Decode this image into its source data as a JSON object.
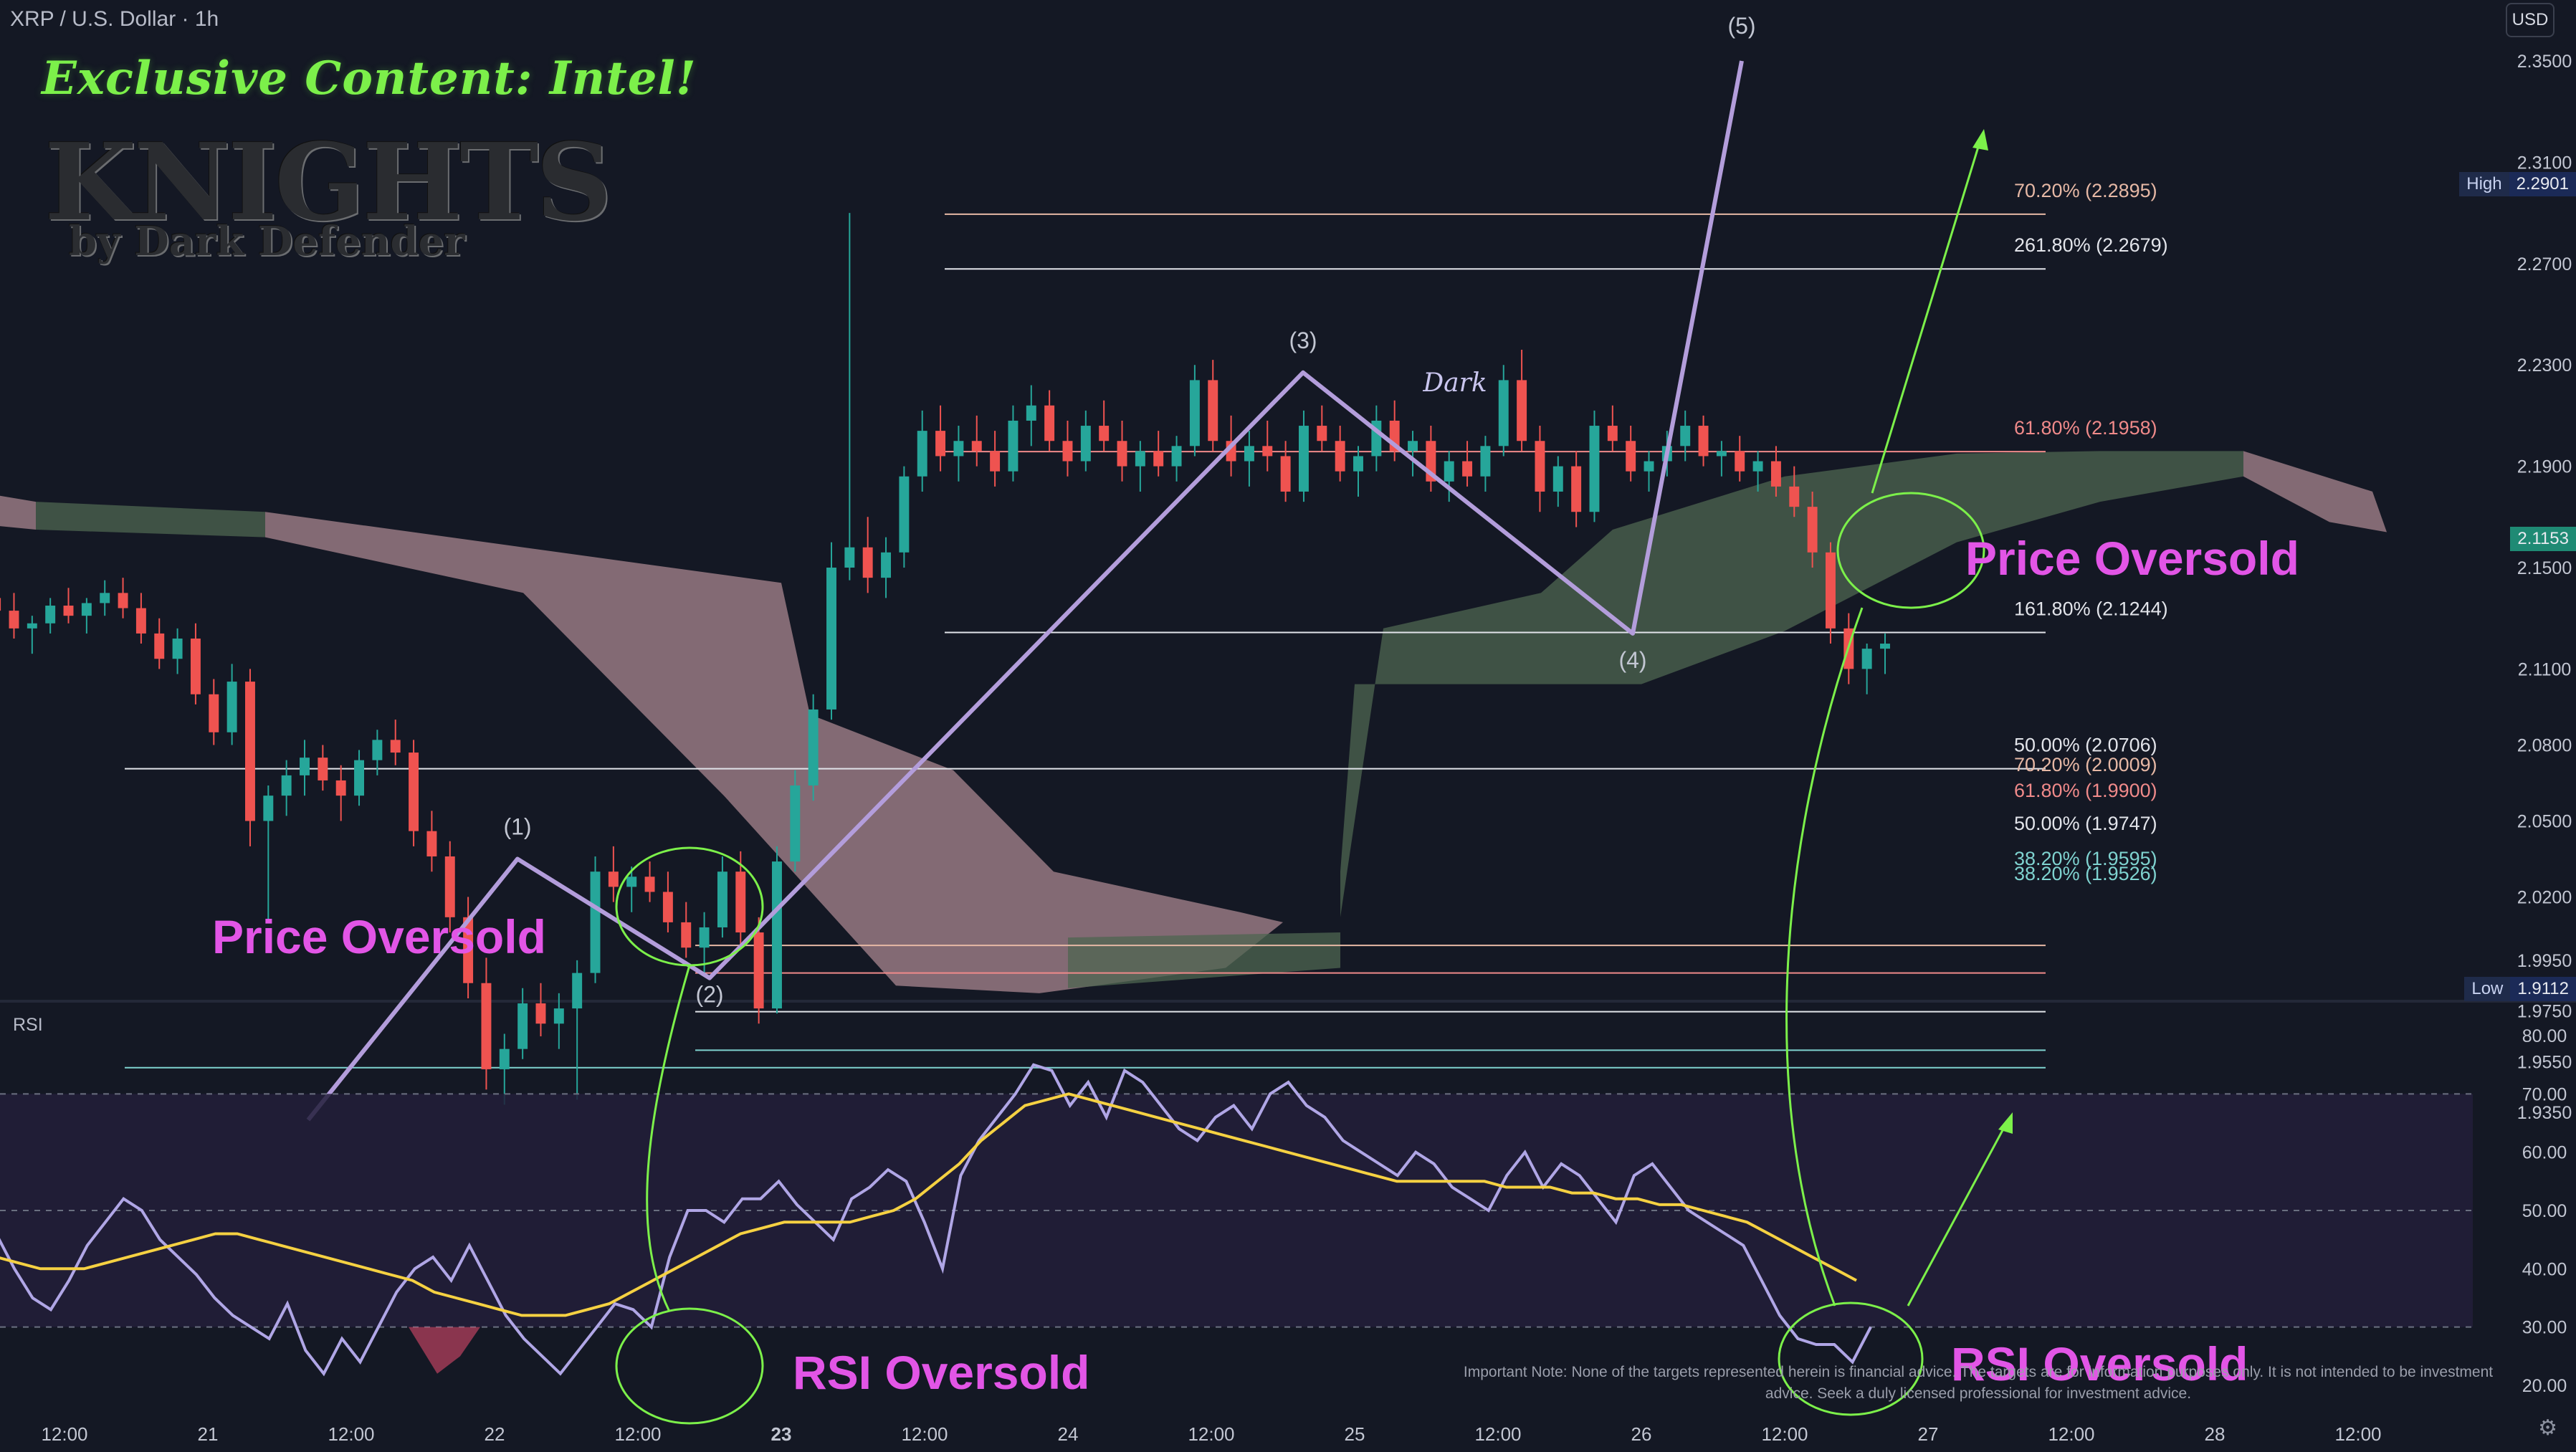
{
  "header": {
    "symbol": "XRP / U.S. Dollar · 1h",
    "currency": "USD"
  },
  "watermark": {
    "tagline": "Exclusive Content: Intel!",
    "brand": "KNIGHTS",
    "byline": "by Dark Defender",
    "mid_label": "Dark"
  },
  "price_tags": {
    "high_label": "High",
    "high_value": "2.2901",
    "current_value": "2.1153",
    "low_label": "Low",
    "low_value": "1.9112"
  },
  "rsi_title": "RSI",
  "disclaimer": "Important Note: None of the targets represented herein is financial advice. The targets are for information purposes only. It is not intended to be investment advice. Seek a duly licensed professional for investment advice.",
  "colors": {
    "background": "#141824",
    "bull": "#26a69a",
    "bear": "#ef5350",
    "wave": "#b39ddb",
    "annotation": "#e255e6",
    "arrow": "#7cf04a",
    "rsi_line": "#b0a6e6",
    "rsi_ma": "#f5d142",
    "cloud_bull": "#4e6650",
    "cloud_bear": "#a8868f"
  },
  "chart_data": [
    {
      "type": "candlestick",
      "pair": "XRP / U.S. Dollar",
      "timeframe": "1h",
      "ylim": [
        1.91,
        2.36
      ],
      "y_ticks": [
        "2.3500",
        "2.3100",
        "2.2700",
        "2.2300",
        "2.1900",
        "2.1500",
        "2.1100",
        "2.0800",
        "2.0500",
        "2.0200",
        "1.9950",
        "1.9750",
        "1.9550",
        "1.9350"
      ],
      "x_ticks": [
        "12:00",
        "21",
        "12:00",
        "22",
        "12:00",
        "23",
        "12:00",
        "24",
        "12:00",
        "25",
        "12:00",
        "26",
        "12:00",
        "27",
        "12:00",
        "28",
        "12:00"
      ],
      "x_range": [
        19.5,
        28.3
      ],
      "high": 2.2901,
      "low": 1.9112,
      "last": 2.1153,
      "ohlc": [
        [
          2.16,
          2.166,
          2.148,
          2.152
        ],
        [
          2.152,
          2.172,
          2.145,
          2.168
        ],
        [
          2.168,
          2.18,
          2.16,
          2.172
        ],
        [
          2.172,
          2.178,
          2.15,
          2.156
        ],
        [
          2.156,
          2.175,
          2.152,
          2.17
        ],
        [
          2.17,
          2.182,
          2.162,
          2.178
        ],
        [
          2.178,
          2.185,
          2.168,
          2.173
        ],
        [
          2.173,
          2.179,
          2.158,
          2.165
        ],
        [
          2.165,
          2.17,
          2.135,
          2.142
        ],
        [
          2.142,
          2.148,
          2.122,
          2.129
        ],
        [
          2.129,
          2.136,
          2.118,
          2.132
        ],
        [
          2.132,
          2.14,
          2.126,
          2.138
        ],
        [
          2.138,
          2.146,
          2.13,
          2.133
        ],
        [
          2.133,
          2.14,
          2.122,
          2.126
        ],
        [
          2.126,
          2.131,
          2.116,
          2.128
        ],
        [
          2.128,
          2.138,
          2.124,
          2.135
        ],
        [
          2.135,
          2.142,
          2.128,
          2.131
        ],
        [
          2.131,
          2.138,
          2.124,
          2.136
        ],
        [
          2.136,
          2.145,
          2.131,
          2.14
        ],
        [
          2.14,
          2.146,
          2.13,
          2.134
        ],
        [
          2.134,
          2.14,
          2.12,
          2.124
        ],
        [
          2.124,
          2.13,
          2.11,
          2.114
        ],
        [
          2.114,
          2.126,
          2.108,
          2.122
        ],
        [
          2.122,
          2.128,
          2.096,
          2.1
        ],
        [
          2.1,
          2.106,
          2.08,
          2.085
        ],
        [
          2.085,
          2.112,
          2.08,
          2.105
        ],
        [
          2.105,
          2.11,
          2.04,
          2.05
        ],
        [
          2.05,
          2.064,
          2.01,
          2.06
        ],
        [
          2.06,
          2.074,
          2.052,
          2.068
        ],
        [
          2.068,
          2.082,
          2.06,
          2.075
        ],
        [
          2.075,
          2.08,
          2.062,
          2.066
        ],
        [
          2.066,
          2.072,
          2.05,
          2.06
        ],
        [
          2.06,
          2.078,
          2.056,
          2.074
        ],
        [
          2.074,
          2.086,
          2.068,
          2.082
        ],
        [
          2.082,
          2.09,
          2.072,
          2.077
        ],
        [
          2.077,
          2.082,
          2.04,
          2.046
        ],
        [
          2.046,
          2.054,
          2.03,
          2.036
        ],
        [
          2.036,
          2.042,
          2.006,
          2.012
        ],
        [
          2.012,
          2.02,
          1.98,
          1.986
        ],
        [
          1.986,
          1.996,
          1.944,
          1.952
        ],
        [
          1.952,
          1.966,
          1.938,
          1.96
        ],
        [
          1.96,
          1.984,
          1.956,
          1.978
        ],
        [
          1.978,
          1.986,
          1.965,
          1.97
        ],
        [
          1.97,
          1.982,
          1.96,
          1.976
        ],
        [
          1.976,
          1.995,
          1.94,
          1.99
        ],
        [
          1.99,
          2.036,
          1.986,
          2.03
        ],
        [
          2.03,
          2.04,
          2.018,
          2.024
        ],
        [
          2.024,
          2.032,
          2.014,
          2.028
        ],
        [
          2.028,
          2.034,
          2.018,
          2.022
        ],
        [
          2.022,
          2.03,
          2.006,
          2.01
        ],
        [
          2.01,
          2.018,
          1.996,
          2.0
        ],
        [
          2.0,
          2.014,
          1.99,
          2.008
        ],
        [
          2.008,
          2.036,
          2.004,
          2.03
        ],
        [
          2.03,
          2.038,
          2.0,
          2.006
        ],
        [
          2.006,
          2.012,
          1.97,
          1.976
        ],
        [
          1.976,
          2.04,
          1.974,
          2.034
        ],
        [
          2.034,
          2.07,
          2.03,
          2.064
        ],
        [
          2.064,
          2.1,
          2.058,
          2.094
        ],
        [
          2.094,
          2.16,
          2.09,
          2.15
        ],
        [
          2.15,
          2.29,
          2.145,
          2.158
        ],
        [
          2.158,
          2.17,
          2.14,
          2.146
        ],
        [
          2.146,
          2.162,
          2.138,
          2.156
        ],
        [
          2.156,
          2.19,
          2.15,
          2.186
        ],
        [
          2.186,
          2.212,
          2.18,
          2.204
        ],
        [
          2.204,
          2.214,
          2.188,
          2.194
        ],
        [
          2.194,
          2.206,
          2.184,
          2.2
        ],
        [
          2.2,
          2.21,
          2.19,
          2.196
        ],
        [
          2.196,
          2.204,
          2.182,
          2.188
        ],
        [
          2.188,
          2.214,
          2.184,
          2.208
        ],
        [
          2.208,
          2.222,
          2.198,
          2.214
        ],
        [
          2.214,
          2.22,
          2.196,
          2.2
        ],
        [
          2.2,
          2.208,
          2.186,
          2.192
        ],
        [
          2.192,
          2.212,
          2.188,
          2.206
        ],
        [
          2.206,
          2.216,
          2.196,
          2.2
        ],
        [
          2.2,
          2.208,
          2.184,
          2.19
        ],
        [
          2.19,
          2.2,
          2.18,
          2.196
        ],
        [
          2.196,
          2.204,
          2.186,
          2.19
        ],
        [
          2.19,
          2.202,
          2.184,
          2.198
        ],
        [
          2.198,
          2.23,
          2.194,
          2.224
        ],
        [
          2.224,
          2.232,
          2.196,
          2.2
        ],
        [
          2.2,
          2.21,
          2.186,
          2.192
        ],
        [
          2.192,
          2.204,
          2.182,
          2.198
        ],
        [
          2.198,
          2.208,
          2.188,
          2.194
        ],
        [
          2.194,
          2.2,
          2.176,
          2.18
        ],
        [
          2.18,
          2.212,
          2.176,
          2.206
        ],
        [
          2.206,
          2.214,
          2.196,
          2.2
        ],
        [
          2.2,
          2.206,
          2.184,
          2.188
        ],
        [
          2.188,
          2.198,
          2.178,
          2.194
        ],
        [
          2.194,
          2.214,
          2.188,
          2.208
        ],
        [
          2.208,
          2.216,
          2.192,
          2.196
        ],
        [
          2.196,
          2.204,
          2.186,
          2.2
        ],
        [
          2.2,
          2.206,
          2.18,
          2.184
        ],
        [
          2.184,
          2.196,
          2.176,
          2.192
        ],
        [
          2.192,
          2.2,
          2.182,
          2.186
        ],
        [
          2.186,
          2.202,
          2.18,
          2.198
        ],
        [
          2.198,
          2.23,
          2.194,
          2.224
        ],
        [
          2.224,
          2.236,
          2.196,
          2.2
        ],
        [
          2.2,
          2.206,
          2.172,
          2.18
        ],
        [
          2.18,
          2.194,
          2.174,
          2.19
        ],
        [
          2.19,
          2.196,
          2.166,
          2.172
        ],
        [
          2.172,
          2.212,
          2.168,
          2.206
        ],
        [
          2.206,
          2.214,
          2.196,
          2.2
        ],
        [
          2.2,
          2.206,
          2.184,
          2.188
        ],
        [
          2.188,
          2.196,
          2.18,
          2.192
        ],
        [
          2.192,
          2.204,
          2.186,
          2.198
        ],
        [
          2.198,
          2.212,
          2.192,
          2.206
        ],
        [
          2.206,
          2.21,
          2.19,
          2.194
        ],
        [
          2.194,
          2.2,
          2.186,
          2.196
        ],
        [
          2.196,
          2.202,
          2.184,
          2.188
        ],
        [
          2.188,
          2.196,
          2.18,
          2.192
        ],
        [
          2.192,
          2.198,
          2.178,
          2.182
        ],
        [
          2.182,
          2.19,
          2.17,
          2.174
        ],
        [
          2.174,
          2.18,
          2.15,
          2.156
        ],
        [
          2.156,
          2.16,
          2.12,
          2.126
        ],
        [
          2.126,
          2.132,
          2.104,
          2.11
        ],
        [
          2.11,
          2.12,
          2.1,
          2.118
        ],
        [
          2.118,
          2.124,
          2.108,
          2.12
        ]
      ],
      "ichimoku_cloud": {
        "bull_color": "green",
        "bear_color": "pink"
      },
      "elliott_wave": [
        {
          "label": "(1)",
          "price": 2.035
        },
        {
          "label": "(2)",
          "price": 1.988
        },
        {
          "label": "(3)",
          "price": 2.227
        },
        {
          "label": "(4)",
          "price": 2.124
        },
        {
          "label": "(5)",
          "price": 2.35
        }
      ],
      "fib_levels_upper": [
        {
          "label": "70.20% (2.2895)",
          "price": 2.2895,
          "color": "#e6b8a5"
        },
        {
          "label": "261.80% (2.2679)",
          "price": 2.2679,
          "color": "#e2e4ea"
        },
        {
          "label": "61.80% (2.1958)",
          "price": 2.1958,
          "color": "#f08a8a"
        },
        {
          "label": "161.80% (2.1244)",
          "price": 2.1244,
          "color": "#e2e4ea"
        },
        {
          "label": "50.00% (2.0706)",
          "price": 2.0706,
          "color": "#e2e4ea"
        }
      ],
      "fib_levels_lower": [
        {
          "label": "70.20% (2.0009)",
          "price": 2.0009,
          "color": "#e6b8a5"
        },
        {
          "label": "61.80% (1.9900)",
          "price": 1.99,
          "color": "#f08a8a"
        },
        {
          "label": "50.00% (1.9747)",
          "price": 1.9747,
          "color": "#e2e4ea"
        },
        {
          "label": "38.20% (1.9595)",
          "price": 1.9595,
          "color": "#7fd3d0"
        },
        {
          "label": "38.20% (1.9526)",
          "price": 1.9526,
          "color": "#7fd3d0"
        }
      ],
      "annotations": [
        "Price Oversold",
        "Price Oversold"
      ]
    },
    {
      "type": "line",
      "title": "RSI",
      "ylim": [
        15,
        85
      ],
      "y_ticks": [
        "80.00",
        "70.00",
        "60.00",
        "50.00",
        "40.00",
        "30.00",
        "20.00"
      ],
      "bands": [
        70,
        50,
        30
      ],
      "series": [
        {
          "values": [
            45,
            42,
            48,
            55,
            57,
            52,
            40,
            36,
            31,
            30,
            36,
            42,
            46,
            40,
            35,
            33,
            38,
            44,
            48,
            52,
            50,
            45,
            42,
            39,
            35,
            32,
            30,
            28,
            34,
            26,
            22,
            28,
            24,
            30,
            36,
            40,
            42,
            38,
            44,
            38,
            32,
            28,
            25,
            22,
            26,
            30,
            34,
            33,
            30,
            42,
            50,
            50,
            48,
            52,
            52,
            55,
            51,
            48,
            45,
            52,
            54,
            57,
            55,
            48,
            40,
            56,
            62,
            66,
            70,
            75,
            74,
            68,
            72,
            66,
            74,
            72,
            68,
            64,
            62,
            66,
            68,
            64,
            70,
            72,
            68,
            66,
            62,
            60,
            58,
            56,
            60,
            58,
            54,
            52,
            50,
            56,
            60,
            54,
            58,
            56,
            52,
            48,
            56,
            58,
            54,
            50,
            48,
            46,
            44,
            38,
            32,
            28,
            27,
            27,
            24,
            30
          ]
        },
        {
          "values": [
            51,
            51,
            50,
            49,
            48,
            47,
            46,
            45,
            44,
            43,
            42,
            41,
            40,
            40,
            40,
            41,
            42,
            43,
            44,
            45,
            46,
            46,
            45,
            44,
            43,
            42,
            41,
            40,
            39,
            38,
            36,
            35,
            34,
            33,
            32,
            32,
            32,
            33,
            34,
            36,
            38,
            40,
            42,
            44,
            46,
            47,
            48,
            48,
            48,
            48,
            49,
            50,
            52,
            55,
            58,
            62,
            65,
            68,
            69,
            70,
            69,
            68,
            67,
            66,
            65,
            64,
            63,
            62,
            61,
            60,
            59,
            58,
            57,
            56,
            55,
            55,
            55,
            55,
            55,
            54,
            54,
            54,
            53,
            53,
            52,
            52,
            51,
            51,
            50,
            49,
            48,
            46,
            44,
            42,
            40,
            38
          ]
        }
      ],
      "annotations": [
        "RSI Oversold",
        "RSI Oversold"
      ]
    }
  ]
}
